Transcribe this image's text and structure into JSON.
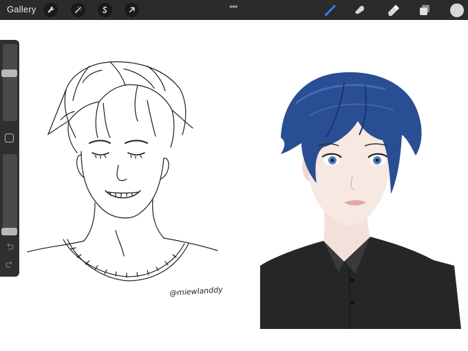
{
  "toolbar": {
    "gallery_label": "Gallery",
    "left_tools": [
      {
        "name": "actions",
        "icon": "wrench-icon"
      },
      {
        "name": "adjustments",
        "icon": "magic-wand-icon"
      },
      {
        "name": "selection",
        "icon": "selection-s-icon"
      },
      {
        "name": "transform",
        "icon": "arrow-cursor-icon"
      }
    ],
    "more_icon": "more-dots-icon",
    "more_label": "•••",
    "right_tools": [
      {
        "name": "brush",
        "icon": "brush-icon",
        "active": true,
        "color": "#2f80ff"
      },
      {
        "name": "smudge",
        "icon": "smudge-icon",
        "active": false
      },
      {
        "name": "eraser",
        "icon": "eraser-icon",
        "active": false
      },
      {
        "name": "layers",
        "icon": "layers-icon",
        "active": false
      }
    ],
    "current_color": "#d7d7d7"
  },
  "sidebar": {
    "brush_size_level": 0.65,
    "opacity_level": 0.05,
    "modify_icon": "square-icon",
    "undo_icon": "undo-icon",
    "redo_icon": "redo-icon"
  },
  "canvas": {
    "signature_text": "@miewlanddy",
    "colors": {
      "hair_blue": "#2a4e93",
      "shirt_black": "#262626",
      "skin": "#f7e8e2",
      "line_art": "#1c1c1c"
    }
  }
}
